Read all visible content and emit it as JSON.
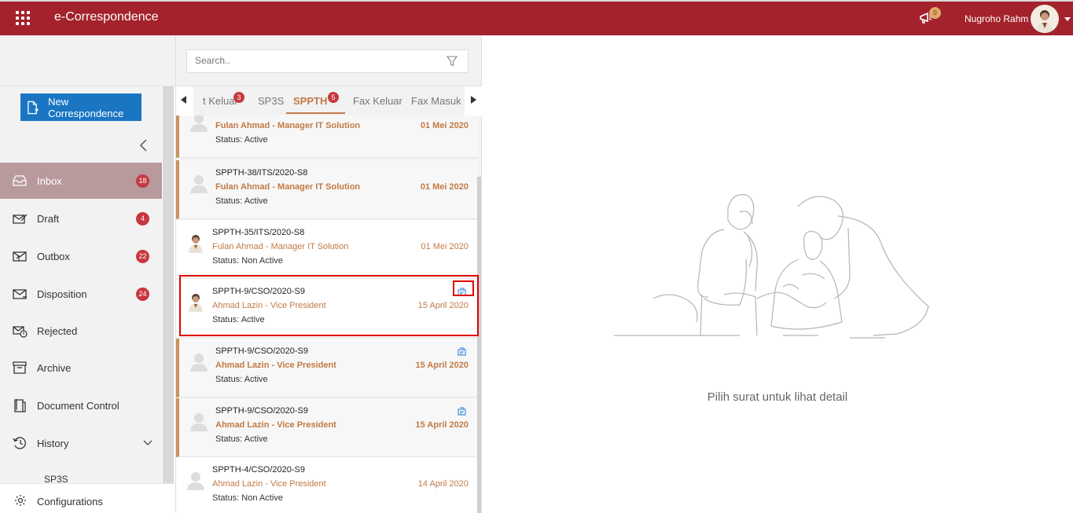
{
  "header": {
    "app_title": "e-Correspondence",
    "notification_count": "0",
    "user_name": "Nugroho Rahm"
  },
  "sidebar": {
    "new_button": "New Correspondence",
    "items": [
      {
        "label": "Inbox",
        "badge": "18",
        "icon": "inbox-icon"
      },
      {
        "label": "Draft",
        "badge": "4",
        "icon": "draft-icon"
      },
      {
        "label": "Outbox",
        "badge": "22",
        "icon": "outbox-icon"
      },
      {
        "label": "Disposition",
        "badge": "24",
        "icon": "disposition-icon"
      },
      {
        "label": "Rejected",
        "badge": "",
        "icon": "rejected-icon"
      },
      {
        "label": "Archive",
        "badge": "",
        "icon": "archive-icon"
      },
      {
        "label": "Document Control",
        "badge": "",
        "icon": "document-control-icon"
      },
      {
        "label": "History",
        "badge": "",
        "icon": "history-icon"
      }
    ],
    "sub_item": "SP3S",
    "configurations": "Configurations"
  },
  "search": {
    "placeholder": "Search.."
  },
  "tabs": [
    {
      "label": "t Keluar",
      "badge": "3"
    },
    {
      "label": "SP3S",
      "badge": ""
    },
    {
      "label": "SPPTH",
      "badge": "5"
    },
    {
      "label": "Fax Keluar",
      "badge": ""
    },
    {
      "label": "Fax Masuk",
      "badge": ""
    }
  ],
  "list": [
    {
      "number": "",
      "sender": "Fulan Ahmad - Manager IT Solution",
      "status": "Status: Active",
      "date": "01 Mei 2020",
      "unread": true,
      "attachment": false
    },
    {
      "number": "SPPTH-38/ITS/2020-S8",
      "sender": "Fulan Ahmad - Manager IT Solution",
      "status": "Status: Active",
      "date": "01 Mei 2020",
      "unread": true,
      "attachment": false
    },
    {
      "number": "SPPTH-35/ITS/2020-S8",
      "sender": "Fulan Ahmad - Manager IT Solution",
      "status": "Status: Non Active",
      "date": "01 Mei 2020",
      "unread": false,
      "attachment": false
    },
    {
      "number": "SPPTH-9/CSO/2020-S9",
      "sender": "Ahmad Lazin - Vice President",
      "status": "Status: Active",
      "date": "15 April 2020",
      "unread": false,
      "attachment": true
    },
    {
      "number": "SPPTH-9/CSO/2020-S9",
      "sender": "Ahmad Lazin - Vice President",
      "status": "Status: Active",
      "date": "15 April 2020",
      "unread": true,
      "attachment": true
    },
    {
      "number": "SPPTH-9/CSO/2020-S9",
      "sender": "Ahmad Lazin - Vice President",
      "status": "Status: Active",
      "date": "15 April 2020",
      "unread": true,
      "attachment": true
    },
    {
      "number": "SPPTH-4/CSO/2020-S9",
      "sender": "Ahmad Lazin - Vice President",
      "status": "Status: Non Active",
      "date": "14 April 2020",
      "unread": false,
      "attachment": false
    }
  ],
  "detail": {
    "empty_text": "Pilih surat untuk lihat detail"
  },
  "colors": {
    "brand": "#a3222b",
    "accent": "#c17a45",
    "button": "#1a75c3",
    "badge": "#c8373f"
  }
}
